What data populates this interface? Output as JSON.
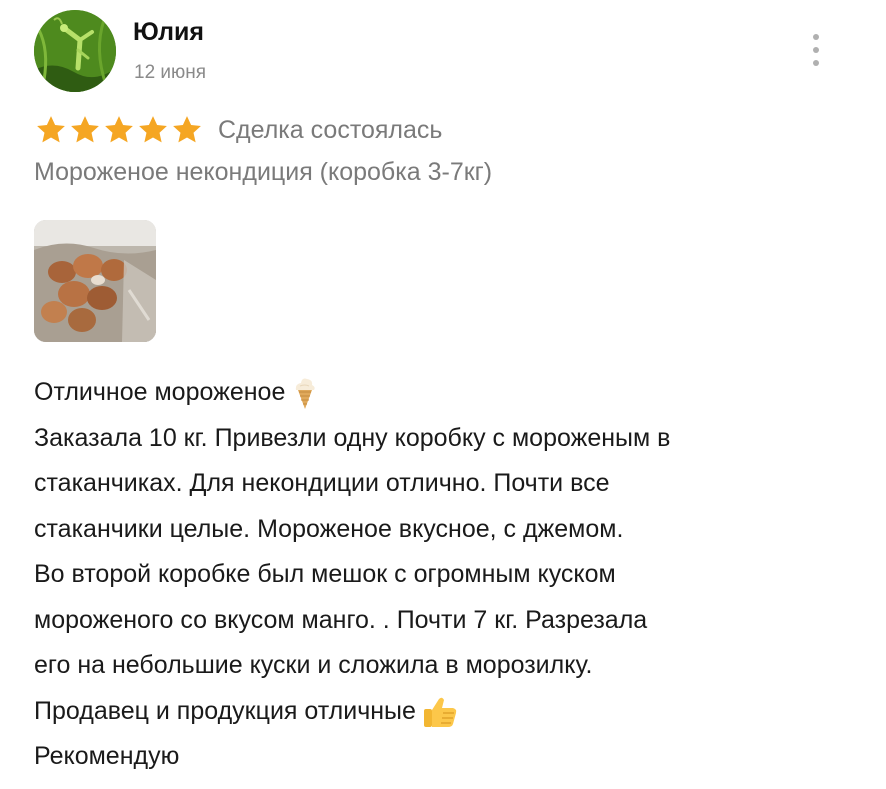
{
  "review": {
    "author": {
      "name": "Юлия",
      "avatar_icon": "praying-mantis-avatar"
    },
    "date": "12 июня",
    "menu_icon": "more-vertical-icon",
    "rating": 5,
    "star_color": "#f5a623",
    "deal_status": "Сделка состоялась",
    "product_name": "Мороженое некондиция (коробка 3-7кг)",
    "photo_icon": "ice-cream-box-photo",
    "text_lines": [
      "Отличное мороженое",
      "Заказала 10 кг. Привезли одну коробку с мороженым в",
      "стаканчиках. Для некондиции отлично. Почти все",
      "стаканчики целые. Мороженое вкусное, с джемом.",
      "Во второй коробке был мешок с огромным куском",
      "мороженого со вкусом манго. . Почти 7 кг. Разрезала",
      "его на небольшие куски и сложила в морозилку.",
      "Продавец и продукция отличные",
      "Рекомендую"
    ],
    "emojis": {
      "line_0": "ice-cream-emoji",
      "line_7": "thumbs-up-emoji"
    }
  }
}
